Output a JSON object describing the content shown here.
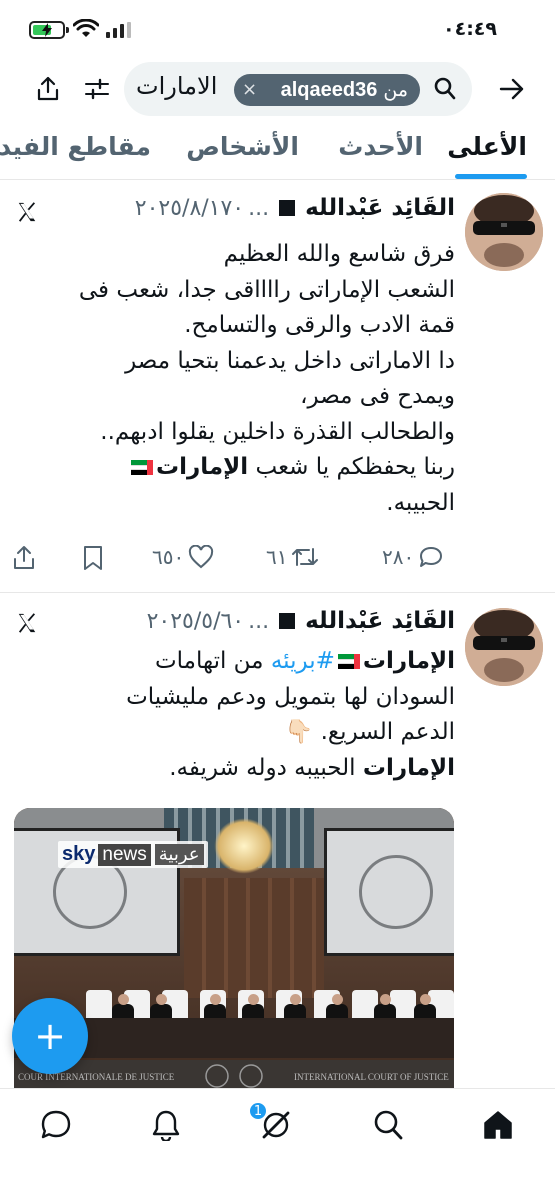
{
  "status_bar": {
    "time": "٠٤:٤٩"
  },
  "search": {
    "query": "الامارات",
    "from_prefix": "من",
    "from_user": "alqaeed36"
  },
  "tabs": [
    {
      "label": "الأعلى"
    },
    {
      "label": "الأحدث"
    },
    {
      "label": "الأشخاص"
    },
    {
      "label": "مقاطع الفيديو"
    }
  ],
  "tweets": [
    {
      "author": "القَائِد عَبْدالله",
      "ellipsis": "...",
      "date": "٢٠٢٥/٨/١٧٠",
      "lines": [
        "فرق شاسع والله العظيم",
        "الشعب الإماراتى رااااقى جدا، شعب فى",
        "قمة الادب والرقى والتسامح.",
        "دا الاماراتى داخل يدعمنا بتحيا مصر",
        "ويمدح فى مصر،",
        "والطحالب القذرة داخلين يقلوا ادبهم..",
        "ربنا يحفظكم يا شعب",
        "الإمارات",
        "الحبيبه."
      ],
      "replies": "٢٨٠",
      "retweets": "٦١",
      "likes": "٦٥٠"
    },
    {
      "author": "القَائِد عَبْدالله",
      "ellipsis": "...",
      "date": "٢٠٢٥/٥/٦٠",
      "lines": [
        "الإمارات",
        "#بريئه",
        "من اتهامات",
        "السودان لها بتمويل ودعم مليشيات",
        "الدعم السريع.",
        "👇🏻",
        "الإمارات",
        "الحبيبه دوله شريفه."
      ],
      "media": {
        "channel_ar": "عربية",
        "channel_en_1": "sky",
        "channel_en_2": "news",
        "caption_left": "COUR INTERNATIONALE DE JUSTICE",
        "caption_right": "INTERNATIONAL COURT OF JUSTICE"
      }
    }
  ],
  "fab": {
    "label": "+"
  },
  "bottom_nav": {
    "notifications_badge": "1"
  }
}
